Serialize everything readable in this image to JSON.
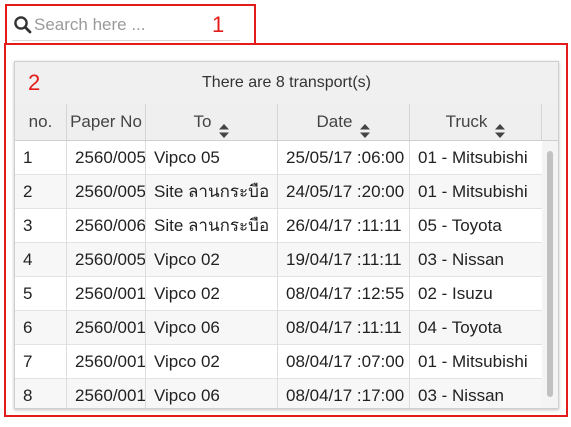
{
  "annotations": {
    "search_label": "1",
    "table_label": "2"
  },
  "search": {
    "placeholder": "Search here ..."
  },
  "table": {
    "caption": "There are 8 transport(s)",
    "columns": [
      "no.",
      "Paper No",
      "To",
      "Date",
      "Truck"
    ],
    "sortable": [
      false,
      false,
      true,
      true,
      true
    ],
    "rows": [
      [
        "1",
        "2560/005",
        "Vipco 05",
        "25/05/17 :06:00",
        "01 - Mitsubishi"
      ],
      [
        "2",
        "2560/005",
        "Site ลานกระบือ",
        "24/05/17 :20:00",
        "01 - Mitsubishi"
      ],
      [
        "3",
        "2560/006",
        "Site ลานกระบือ",
        "26/04/17 :11:11",
        "05 - Toyota"
      ],
      [
        "4",
        "2560/005",
        "Vipco 02",
        "19/04/17 :11:11",
        "03 - Nissan"
      ],
      [
        "5",
        "2560/001",
        "Vipco 02",
        "08/04/17 :12:55",
        "02 - Isuzu"
      ],
      [
        "6",
        "2560/001",
        "Vipco 06",
        "08/04/17 :11:11",
        "04 - Toyota"
      ],
      [
        "7",
        "2560/001",
        "Vipco 02",
        "08/04/17 :07:00",
        "01 - Mitsubishi"
      ],
      [
        "8",
        "2560/001",
        "Vipco 06",
        "08/04/17 :17:00",
        "03 - Nissan"
      ]
    ]
  },
  "colors": {
    "annotation": "#e41b1b",
    "header_bg": "#efefef",
    "alt_row": "#f7f7f7"
  },
  "icons": {
    "search": "search-icon",
    "sort": "sort-icon"
  }
}
